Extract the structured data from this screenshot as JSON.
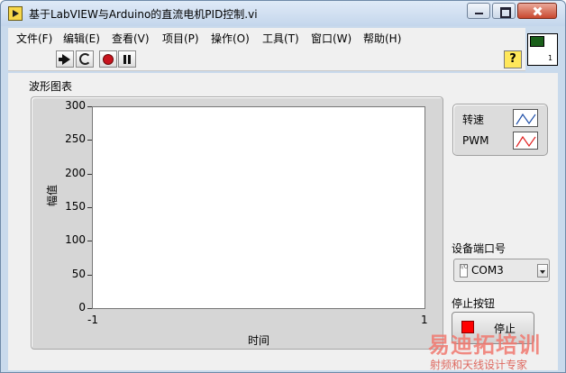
{
  "window": {
    "title": "基于LabVIEW与Arduino的直流电机PID控制.vi"
  },
  "menu": [
    {
      "label": "文件(F)"
    },
    {
      "label": "编辑(E)"
    },
    {
      "label": "查看(V)"
    },
    {
      "label": "项目(P)"
    },
    {
      "label": "操作(O)"
    },
    {
      "label": "工具(T)"
    },
    {
      "label": "窗口(W)"
    },
    {
      "label": "帮助(H)"
    }
  ],
  "toolbar": {
    "icons": [
      "run-arrow-icon",
      "run-continuously-icon",
      "abort-icon",
      "pause-icon"
    ],
    "help_label": "?"
  },
  "vi_icon": {
    "number": "1"
  },
  "graph": {
    "label": "波形图表",
    "y_title": "幅值",
    "x_title": "时间",
    "y_ticks": [
      "300",
      "250",
      "200",
      "150",
      "100",
      "50",
      "0"
    ],
    "x_ticks": [
      "-1",
      "1"
    ]
  },
  "chart_data": {
    "type": "line",
    "title": "波形图表",
    "xlabel": "时间",
    "ylabel": "幅值",
    "xlim": [
      -1,
      1
    ],
    "ylim": [
      0,
      300
    ],
    "series": [
      {
        "name": "转速",
        "values": []
      },
      {
        "name": "PWM",
        "values": []
      }
    ]
  },
  "legend": [
    {
      "name": "转速",
      "color": "#1f4fa8"
    },
    {
      "name": "PWM",
      "color": "#e02020"
    }
  ],
  "port": {
    "label": "设备端口号",
    "value": "COM3",
    "io_icon": "I/O"
  },
  "stop": {
    "label": "停止按钮",
    "text": "停止",
    "led_color": "#ff0000"
  },
  "watermark": {
    "main": "易迪拓培训",
    "sub": "射频和天线设计专家"
  }
}
